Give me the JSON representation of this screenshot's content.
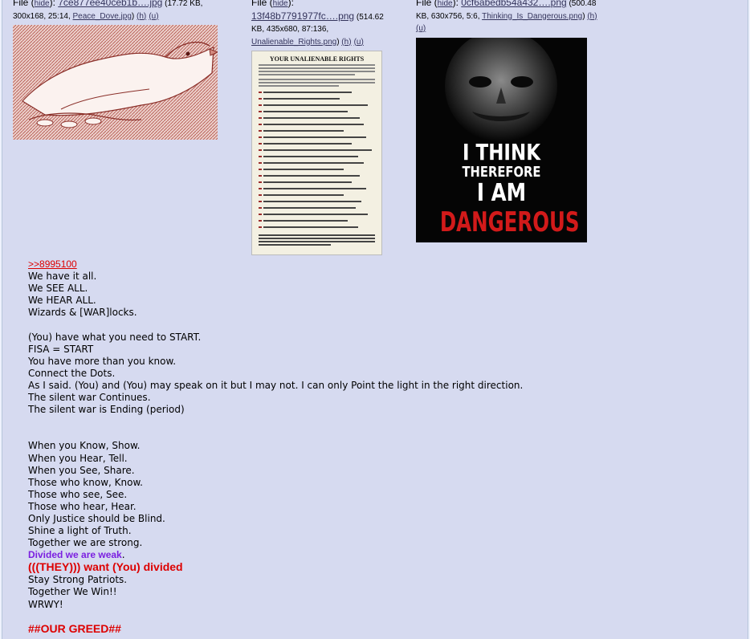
{
  "files": [
    {
      "prefix": "File (",
      "hide": "hide",
      "sep": "): ",
      "filename": "7ce877ee40ceb1b….jpg",
      "meta1": " (17.72 KB,",
      "meta2": "300x168, 25:14, ",
      "original": "Peace_Dove.jpg",
      "close": ") ",
      "h": "(h)",
      "u": "(u)"
    },
    {
      "prefix": "File (",
      "hide": "hide",
      "sep": "):",
      "filename": "13f48b7791977fc….png",
      "meta1": " (514.62",
      "meta2": "KB, 435x680, 87:136,",
      "original": "Unalienable_Rights.png",
      "close": ") ",
      "h": "(h)",
      "u": "(u)"
    },
    {
      "prefix": "File (",
      "hide": "hide",
      "sep": "): ",
      "filename": "0cf6abedb54a432….png",
      "meta1": " (500.48",
      "meta2": "KB, 630x756, 5:6, ",
      "original": "Thinking_Is_Dangerous.png",
      "close": ") ",
      "h": "(h)",
      "u": "(u)"
    }
  ],
  "thumbs": {
    "rights_title": "YOUR UNALIENABLE RIGHTS",
    "poster_line1": "I THINK",
    "poster_line2": "THEREFORE",
    "poster_line3": "I AM",
    "poster_line4": "DANGEROUS"
  },
  "message": {
    "quote": ">>8995100",
    "lines_a": [
      "We have it all.",
      "We SEE ALL.",
      "We HEAR ALL.",
      "Wizards & [WAR]locks."
    ],
    "lines_b": [
      "(You) have what you need to START.",
      "FISA = START",
      "You have more than you know.",
      "Connect the Dots.",
      "As I said. (You) and (You) may speak on it but I may not. I can only Point the light in the right direction.",
      "The silent war Continues.",
      "The silent war is Ending (period)"
    ],
    "lines_c": [
      "When you Know, Show.",
      "When you Hear, Tell.",
      "When you See, Share.",
      "Those who know, Know.",
      "Those who see, See.",
      "Those who hear, Hear.",
      "Only Justice should be Blind.",
      "Shine a light of Truth.",
      "Together we are strong."
    ],
    "purple": "Divided we are weak",
    "purple_tail": ".",
    "red": "(((THEY))) want (You) divided",
    "lines_d": [
      "Stay Strong Patriots.",
      "Together We Win!!",
      "WRWY!"
    ],
    "greed": "##OUR GREED##"
  },
  "colors": {
    "quote": "#dd0000",
    "purple": "#7b1fe0",
    "post_bg": "#d6daf0"
  }
}
